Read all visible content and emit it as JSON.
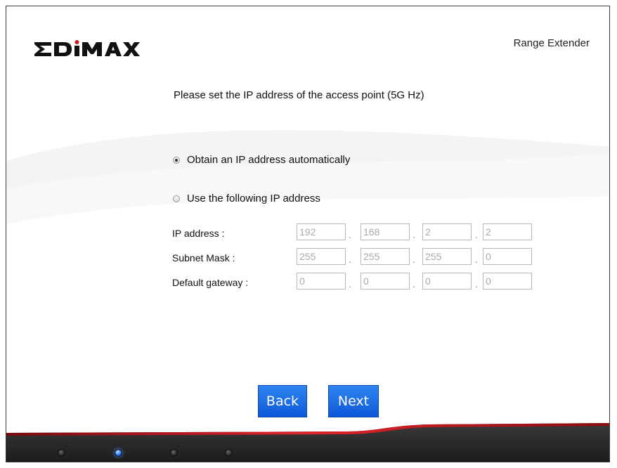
{
  "header": {
    "brand": "EDIMAX",
    "product_label": "Range Extender"
  },
  "main": {
    "heading": "Please set the IP address of the access point (5G Hz)",
    "options": [
      {
        "label": "Obtain an IP address automatically",
        "selected": true
      },
      {
        "label": "Use the following IP address",
        "selected": false
      }
    ],
    "ip_config": {
      "rows": [
        {
          "label": "IP address :",
          "octets": [
            "192",
            "168",
            "2",
            "2"
          ]
        },
        {
          "label": "Subnet Mask :",
          "octets": [
            "255",
            "255",
            "255",
            "0"
          ]
        },
        {
          "label": "Default gateway :",
          "octets": [
            "0",
            "0",
            "0",
            "0"
          ]
        }
      ],
      "separator": "."
    }
  },
  "buttons": {
    "back": "Back",
    "next": "Next"
  },
  "progress": {
    "steps": 4,
    "current_step": 2
  },
  "colors": {
    "button_blue": "#1f6fe6",
    "accent_red": "#c4161c",
    "led_active": "#2f7bff"
  }
}
